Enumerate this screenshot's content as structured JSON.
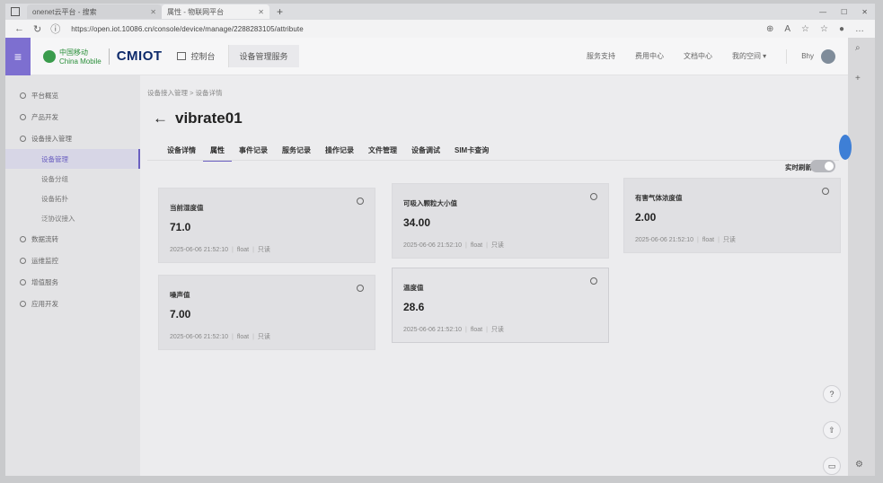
{
  "browser": {
    "tabs": [
      {
        "label": "onenet云平台 - 搜索"
      },
      {
        "label": "属性 - 物联网平台"
      }
    ],
    "url": "https://open.iot.10086.cn/console/device/manage/2288283105/attribute"
  },
  "header": {
    "brand_cn": "中国移动",
    "brand_en": "China Mobile",
    "brand_iot": "CMIOT",
    "console_label": "控制台",
    "service_label": "设备管理服务",
    "links": [
      "服务支持",
      "费用中心",
      "文档中心",
      "我的空间 ▾"
    ],
    "user": "Bhy"
  },
  "sidebar": {
    "items": [
      {
        "label": "平台概览"
      },
      {
        "label": "产品开发"
      },
      {
        "label": "设备接入管理"
      }
    ],
    "subitems": [
      {
        "label": "设备管理",
        "active": true
      },
      {
        "label": "设备分组"
      },
      {
        "label": "设备拓扑"
      },
      {
        "label": "泛协议接入"
      }
    ],
    "items2": [
      {
        "label": "数据流转"
      },
      {
        "label": "运维监控"
      },
      {
        "label": "增值服务"
      },
      {
        "label": "应用开发"
      }
    ]
  },
  "main": {
    "breadcrumb": "设备接入管理  >  设备详情",
    "title": "vibrate01",
    "tabs": [
      {
        "label": "设备详情"
      },
      {
        "label": "属性",
        "active": true
      },
      {
        "label": "事件记录"
      },
      {
        "label": "服务记录"
      },
      {
        "label": "操作记录"
      },
      {
        "label": "文件管理"
      },
      {
        "label": "设备调试"
      },
      {
        "label": "SIM卡查询"
      }
    ],
    "realtime_label": "实时刷新",
    "cards": [
      {
        "name": "当前湿度值",
        "value": "71.0",
        "time": "2025-06-06 21:52:10",
        "type": "float",
        "mode": "只读"
      },
      {
        "name": "可吸入颗粒大小值",
        "value": "34.00",
        "time": "2025-06-06 21:52:10",
        "type": "float",
        "mode": "只读"
      },
      {
        "name": "有害气体浓度值",
        "value": "2.00",
        "time": "2025-06-06 21:52:10",
        "type": "float",
        "mode": "只读"
      },
      {
        "name": "噪声值",
        "value": "7.00",
        "time": "2025-06-06 21:52:10",
        "type": "float",
        "mode": "只读"
      },
      {
        "name": "温度值",
        "value": "28.6",
        "time": "2025-06-06 21:52:10",
        "type": "float",
        "mode": "只读"
      }
    ]
  }
}
